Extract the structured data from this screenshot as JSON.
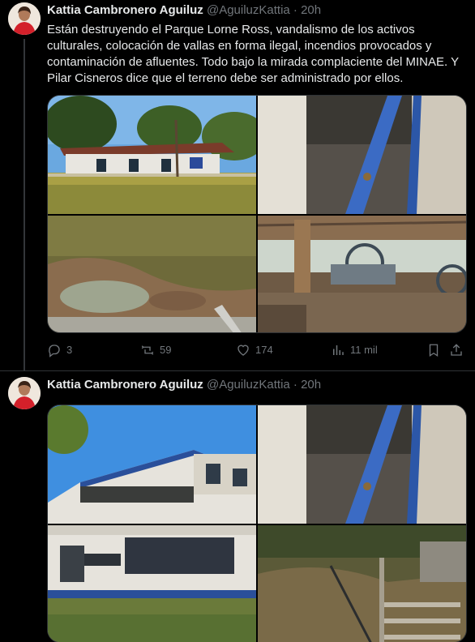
{
  "tweets": [
    {
      "author": "Kattia Cambronero Aguiluz",
      "handle": "@AguiluzKattia",
      "separator": "·",
      "time": "20h",
      "text": "Están destruyendo el Parque Lorne Ross, vandalismo de los activos culturales, colocación de vallas en forma ilegal, incendios provocados y contaminación de afluentes. Todo bajo la mirada complaciente del MINAE. Y Pilar Cisneros dice que el terreno debe ser administrado por ellos.",
      "replies": "3",
      "retweets": "59",
      "likes": "174",
      "views": "11 mil"
    },
    {
      "author": "Kattia Cambronero Aguiluz",
      "handle": "@AguiluzKattia",
      "separator": "·",
      "time": "20h"
    }
  ],
  "icons": {
    "reply": "reply-icon",
    "retweet": "retweet-icon",
    "like": "heart-icon",
    "views": "views-icon",
    "bookmark": "bookmark-icon",
    "share": "share-icon"
  },
  "colors": {
    "background": "#000000",
    "text": "#e7e9ea",
    "secondary": "#71767b",
    "border": "#2f3336"
  }
}
